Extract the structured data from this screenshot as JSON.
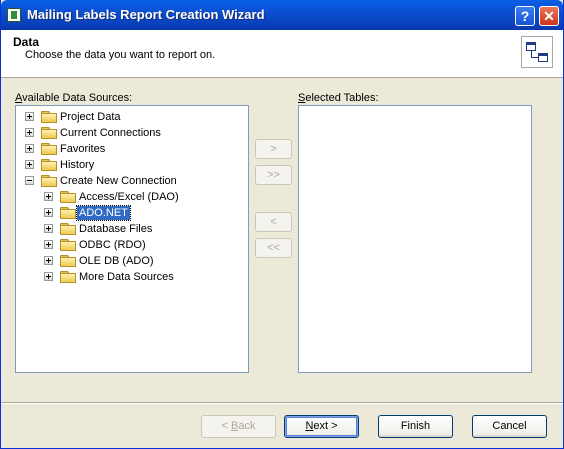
{
  "window": {
    "title": "Mailing Labels Report Creation Wizard",
    "help_label": "?",
    "close_label": "✕"
  },
  "header": {
    "title": "Data",
    "subtitle": "Choose the data you want to report on."
  },
  "available": {
    "label_accel": "A",
    "label_rest": "vailable Data Sources:",
    "tree": [
      {
        "label": "Project Data",
        "level": 0,
        "expander": "plus"
      },
      {
        "label": "Current Connections",
        "level": 0,
        "expander": "plus"
      },
      {
        "label": "Favorites",
        "level": 0,
        "expander": "plus"
      },
      {
        "label": "History",
        "level": 0,
        "expander": "plus"
      },
      {
        "label": "Create New Connection",
        "level": 0,
        "expander": "minus"
      },
      {
        "label": "Access/Excel (DAO)",
        "level": 1,
        "expander": "plus"
      },
      {
        "label": "ADO.NET",
        "level": 1,
        "expander": "plus",
        "selected": true
      },
      {
        "label": "Database Files",
        "level": 1,
        "expander": "plus"
      },
      {
        "label": "ODBC (RDO)",
        "level": 1,
        "expander": "plus"
      },
      {
        "label": "OLE DB (ADO)",
        "level": 1,
        "expander": "plus"
      },
      {
        "label": "More Data Sources",
        "level": 1,
        "expander": "plus"
      }
    ]
  },
  "selected_tables": {
    "label_accel": "S",
    "label_rest": "elected Tables:"
  },
  "transfer_buttons": {
    "add": ">",
    "add_all": ">>",
    "remove": "<",
    "remove_all": "<<"
  },
  "footer": {
    "back_prefix": "< ",
    "back_accel": "B",
    "back_rest": "ack",
    "next_accel": "N",
    "next_rest": "ext >",
    "finish": "Finish",
    "cancel": "Cancel"
  },
  "colors": {
    "titlebar": "#0a4fd1",
    "selection": "#316ac5",
    "dialog_bg": "#ece9d8"
  }
}
